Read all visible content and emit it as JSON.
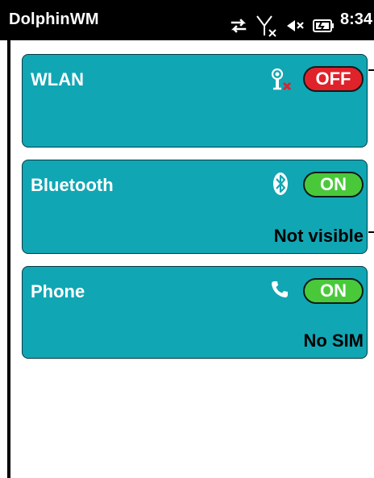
{
  "statusbar": {
    "title": "DolphinWM",
    "time": "8:34",
    "icons": [
      "sync-arrows-icon",
      "signal-off-icon",
      "volume-muted-icon",
      "battery-charging-icon"
    ]
  },
  "cards": {
    "wlan": {
      "title": "WLAN",
      "toggle": "OFF",
      "icon": "wifi-disabled-icon",
      "status": ""
    },
    "bluetooth": {
      "title": "Bluetooth",
      "toggle": "ON",
      "icon": "bluetooth-icon",
      "status": "Not visible"
    },
    "phone": {
      "title": "Phone",
      "toggle": "ON",
      "icon": "phone-icon",
      "status": "No SIM"
    }
  },
  "colors": {
    "card_bg": "#11a6b4",
    "off": "#e0222a",
    "on": "#49c93a",
    "statusbar_bg": "#000000"
  }
}
